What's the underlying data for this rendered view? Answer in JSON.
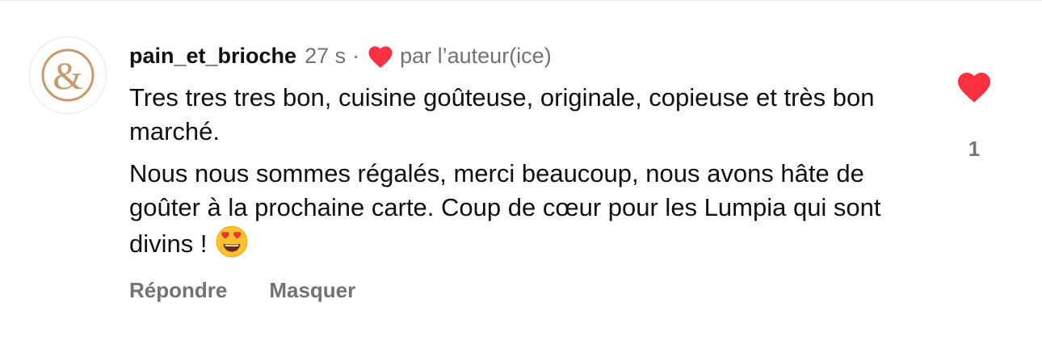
{
  "comment": {
    "username": "pain_et_brioche",
    "timestamp": "27 s",
    "separator": "·",
    "liked_by_author_label": "par l’auteur(ice)",
    "paragraphs": [
      "Tres tres tres bon, cuisine goûteuse, originale, copieuse et très bon marché.",
      "Nous nous sommes régalés, merci beaucoup, nous avons hâte de goûter à la prochaine carte. Coup de cœur pour les Lumpia qui sont divins !"
    ],
    "trailing_emoji": "heart-eyes-emoji",
    "like_count": "1",
    "liked": true
  },
  "actions": {
    "reply_label": "Répondre",
    "hide_label": "Masquer"
  },
  "avatar": {
    "logo": "ampersand-logo",
    "accent_color": "#c79a6b"
  },
  "colors": {
    "heart": "#ff3040",
    "secondary_text": "#737373",
    "primary_text": "#111111"
  }
}
